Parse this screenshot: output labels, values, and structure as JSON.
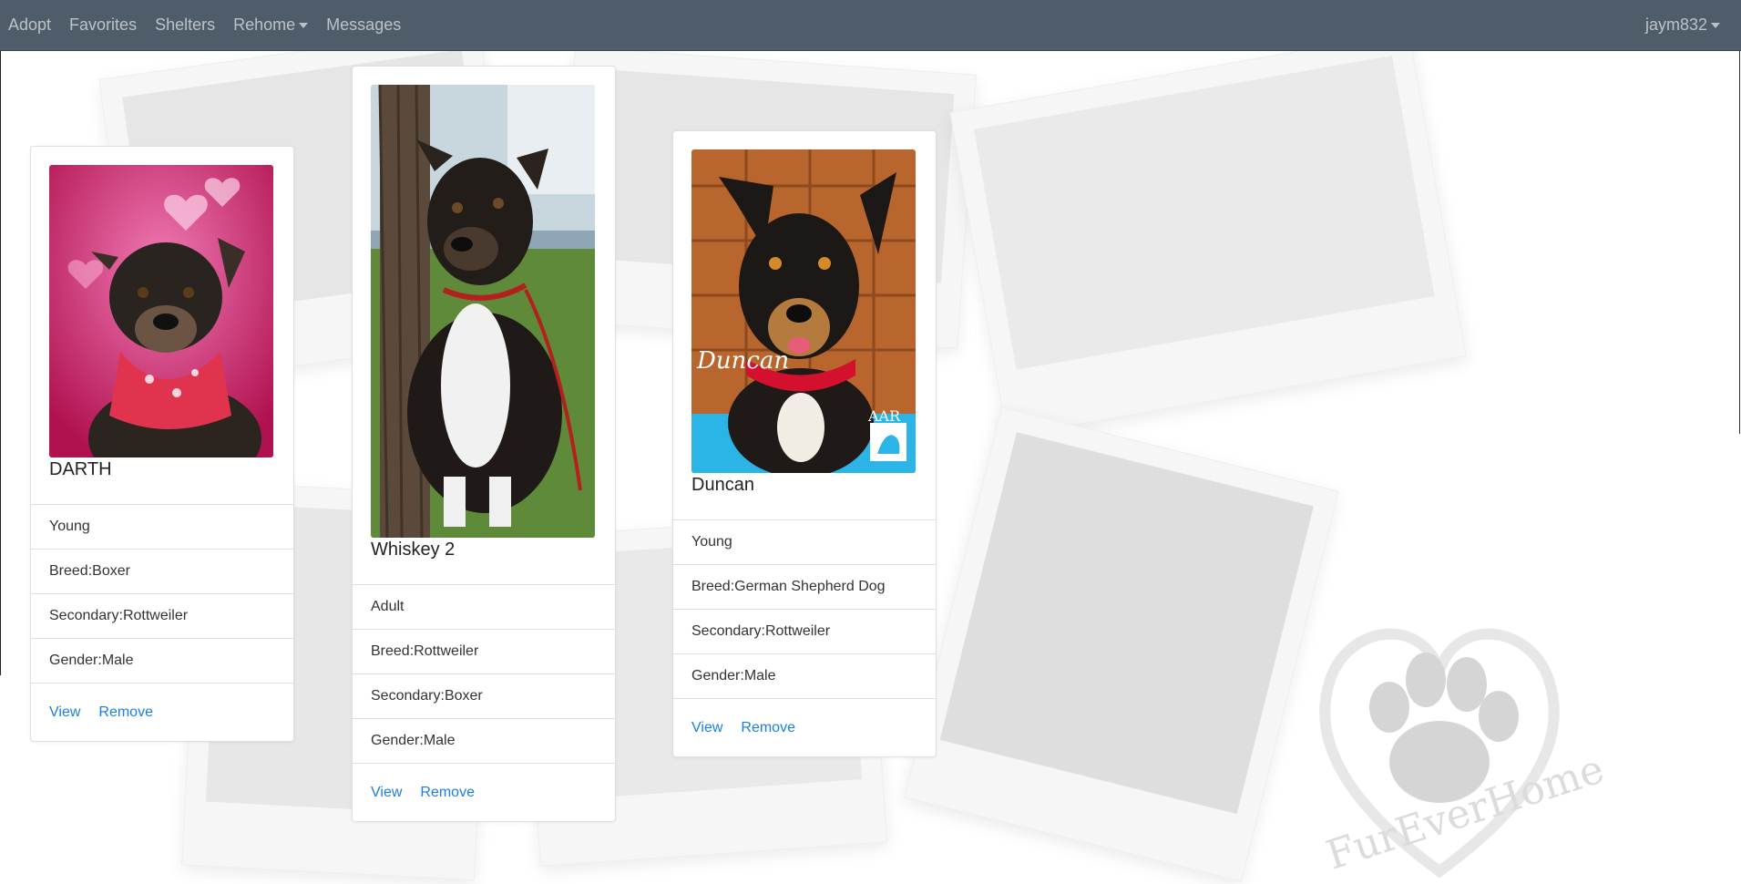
{
  "nav": {
    "items": [
      "Adopt",
      "Favorites",
      "Shelters",
      "Rehome",
      "Messages"
    ],
    "user": "jaym832"
  },
  "background": {
    "logo_text": "FurEverHome"
  },
  "cards": [
    {
      "name": "DARTH",
      "age": "Young",
      "breed": "Breed:Boxer",
      "secondary": "Secondary:Rottweiler",
      "gender": "Gender:Male",
      "view_label": "View",
      "remove_label": "Remove"
    },
    {
      "name": "Whiskey 2",
      "age": "Adult",
      "breed": "Breed:Rottweiler",
      "secondary": "Secondary:Boxer",
      "gender": "Gender:Male",
      "view_label": "View",
      "remove_label": "Remove"
    },
    {
      "name": "Duncan",
      "photo_caption": "Duncan",
      "photo_badge": "AAR",
      "age": "Young",
      "breed": "Breed:German Shepherd Dog",
      "secondary": "Secondary:Rottweiler",
      "gender": "Gender:Male",
      "view_label": "View",
      "remove_label": "Remove"
    }
  ],
  "colors": {
    "navbar": "#4f5d6b",
    "link": "#1a7ee6"
  }
}
